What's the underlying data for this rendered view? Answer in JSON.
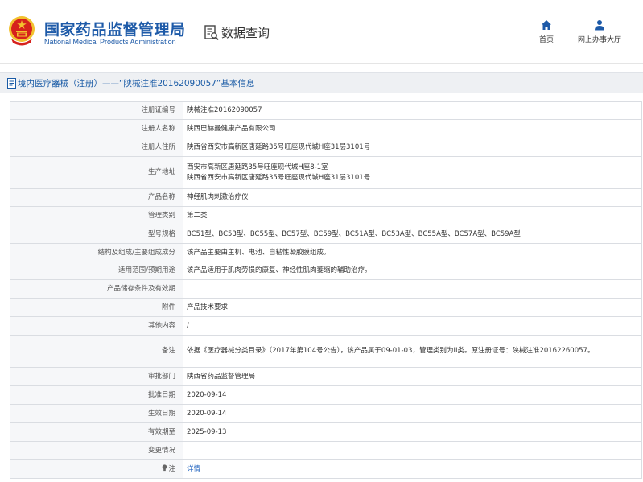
{
  "header": {
    "logo_cn": "国家药品监督管理局",
    "logo_en": "National Medical Products Administration",
    "query_title": "数据查询",
    "nav": [
      {
        "label": "首页",
        "icon": "home-icon"
      },
      {
        "label": "网上办事大厅",
        "icon": "user-icon"
      }
    ]
  },
  "page_title": "境内医疗器械（注册）——“陕械注准20162090057”基本信息",
  "colors": {
    "brand_blue": "#1d5aa8",
    "link_blue": "#2a6ac2",
    "emblem_red": "#d6211c",
    "emblem_gold": "#f2c12e"
  },
  "rows": [
    {
      "label": "注册证编号",
      "value": "陕械注准20162090057"
    },
    {
      "label": "注册人名称",
      "value": "陕西巴赫曼健康产品有限公司"
    },
    {
      "label": "注册人住所",
      "value": "陕西省西安市高新区唐延路35号旺座现代城H座31层3101号"
    },
    {
      "label": "生产地址",
      "value": "西安市高新区唐延路35号旺座现代城H座8-1室",
      "value2": "陕西省西安市高新区唐延路35号旺座现代城H座31层3101号"
    },
    {
      "label": "产品名称",
      "value": "神经肌肉刺激治疗仪"
    },
    {
      "label": "管理类别",
      "value": "第二类"
    },
    {
      "label": "型号规格",
      "value": "BC51型、BC53型、BC55型、BC57型、BC59型、BC51A型、BC53A型、BC55A型、BC57A型、BC59A型"
    },
    {
      "label": "结构及组成/主要组成成分",
      "value": "该产品主要由主机、电池、自粘性凝胶膜组成。"
    },
    {
      "label": "适用范围/预期用途",
      "value": "该产品适用于肌肉劳损的康复、神经性肌肉萎缩的辅助治疗。"
    },
    {
      "label": "产品储存条件及有效期",
      "value": ""
    },
    {
      "label": "附件",
      "value": "产品技术要求"
    },
    {
      "label": "其他内容",
      "value": "/"
    },
    {
      "label": "备注",
      "value": "依据《医疗器械分类目录》（2017年第104号公告），该产品属于09-01-03，管理类别为II类。原注册证号：陕械注准20162260057。"
    },
    {
      "label": "审批部门",
      "value": "陕西省药品监督管理局"
    },
    {
      "label": "批准日期",
      "value": "2020-09-14"
    },
    {
      "label": "生效日期",
      "value": "2020-09-14"
    },
    {
      "label": "有效期至",
      "value": "2025-09-13"
    },
    {
      "label": "变更情况",
      "value": ""
    },
    {
      "label": "注",
      "value": "详情",
      "label_icon": "lightbulb-icon"
    }
  ]
}
